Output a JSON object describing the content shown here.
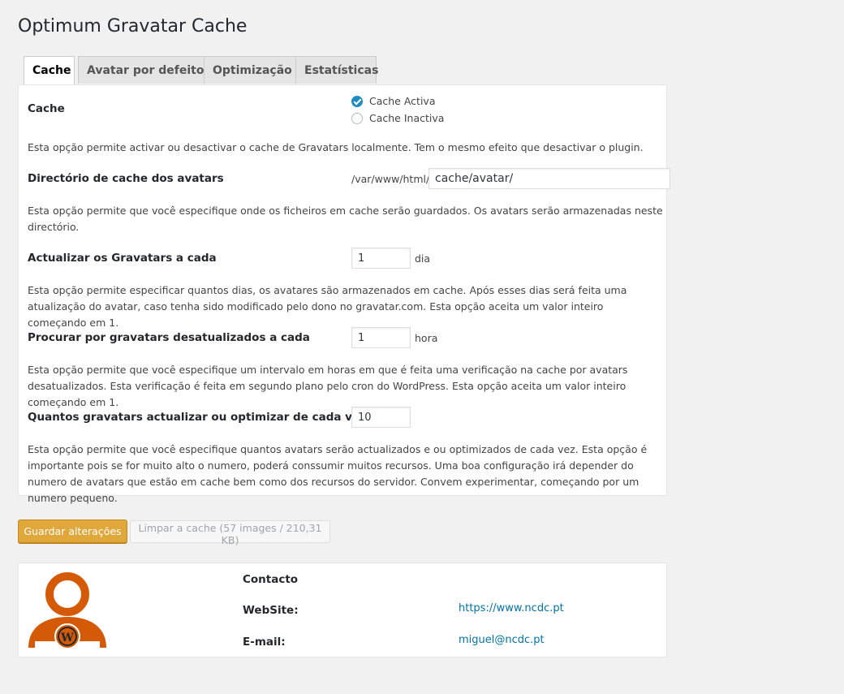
{
  "page": {
    "title": "Optimum Gravatar Cache"
  },
  "tabs": [
    {
      "label": "Cache",
      "active": true
    },
    {
      "label": "Avatar por defeito",
      "active": false
    },
    {
      "label": "Optimização",
      "active": false
    },
    {
      "label": "Estatísticas",
      "active": false
    }
  ],
  "settings": {
    "cache": {
      "label": "Cache",
      "options": [
        {
          "label": "Cache Activa",
          "checked": true
        },
        {
          "label": "Cache Inactiva",
          "checked": false
        }
      ],
      "description": "Esta opção permite activar ou desactivar o cache de Gravatars localmente. Tem o mesmo efeito que desactivar o plugin."
    },
    "directory": {
      "label": "Directório de cache dos avatars",
      "prefix": "/var/www/html/",
      "value": "cache/avatar/",
      "description": "Esta opção permite que você especifique onde os ficheiros em cache serão guardados. Os avatars serão armazenadas neste directório."
    },
    "refresh": {
      "label": "Actualizar os Gravatars a cada",
      "value": "1",
      "unit": "dia",
      "description": "Esta opção permite especificar quantos dias, os avatares são armazenados em cache. Após esses dias será feita uma atualização do avatar, caso tenha sido modificado pelo dono no gravatar.com. Esta opção aceita um valor inteiro começando em 1."
    },
    "check": {
      "label": "Procurar por gravatars desatualizados a cada",
      "value": "1",
      "unit": "hora",
      "description": "Esta opção permite que você especifique um intervalo em horas em que é feita uma verificação na cache por avatars desatualizados. Esta verificação é feita em segundo plano pelo cron do WordPress. Esta opção aceita um valor inteiro começando em 1."
    },
    "batch": {
      "label": "Quantos gravatars actualizar ou optimizar de cada vez",
      "value": "10",
      "description": "Esta opção permite que você especifique quantos avatars serão actualizados e ou optimizados de cada vez. Esta opção é importante pois se for muito alto o numero, poderá conssumir muitos recursos. Uma boa configuração irá depender do numero de avatars que estão em cache bem como dos recursos do servidor. Convem experimentar, começando por um numero pequeno."
    }
  },
  "buttons": {
    "save": "Guardar alterações",
    "clear": "Limpar a cache (57 images / 210,31 KB)"
  },
  "contact": {
    "heading": "Contacto",
    "website_label": "WebSite:",
    "website_url": "https://www.ncdc.pt",
    "email_label": "E-mail:",
    "email": "miguel@ncdc.pt",
    "logo_color": "#d55a08"
  }
}
